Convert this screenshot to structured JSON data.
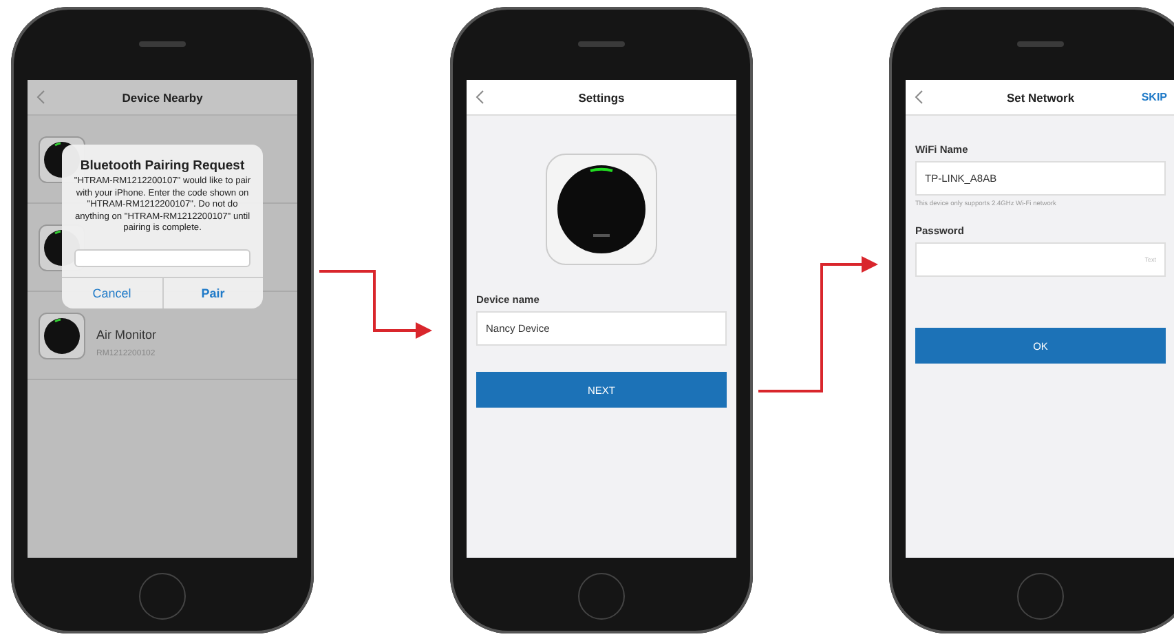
{
  "device_nearby_screen": {
    "title": "Device Nearby",
    "devices": [
      {
        "name": "Air Monitor",
        "serial": "RM1212200102"
      }
    ],
    "pairing_dialog": {
      "title": "Bluetooth Pairing Request",
      "message": "\"HTRAM-RM1212200107\" would like to pair with your iPhone. Enter the code shown on \"HTRAM-RM1212200107\". Do not do anything on \"HTRAM-RM1212200107\" until pairing is complete.",
      "buttons": [
        "Cancel",
        "Pair"
      ]
    }
  },
  "settings_screen": {
    "title": "Settings",
    "device_name_label": "Device name",
    "device_name_value": "Nancy Device",
    "next_button": "NEXT"
  },
  "set_network_screen": {
    "title": "Set Network",
    "skip_button": "SKIP",
    "wifi_label": "WiFi Name",
    "wifi_value": "TP-LINK_A8AB",
    "wifi_hint": "This device only supports 2.4GHz Wi-Fi network",
    "password_label": "Password",
    "password_placeholder": "Text",
    "ok_button": "OK"
  }
}
